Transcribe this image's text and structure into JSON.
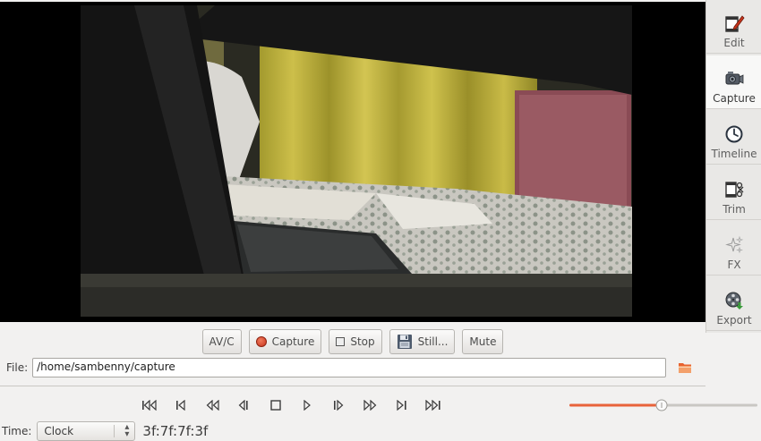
{
  "controls": {
    "avc_label": "AV/C",
    "capture_label": "Capture",
    "stop_label": "Stop",
    "still_label": "Still...",
    "mute_label": "Mute"
  },
  "file": {
    "label": "File:",
    "value": "/home/sambenny/capture"
  },
  "sidebar": {
    "items": [
      {
        "label": "Edit",
        "icon": "edit-icon"
      },
      {
        "label": "Capture",
        "icon": "camera-icon",
        "active": true
      },
      {
        "label": "Timeline",
        "icon": "clock-icon"
      },
      {
        "label": "Trim",
        "icon": "trim-icon"
      },
      {
        "label": "FX",
        "icon": "sparkle-icon"
      },
      {
        "label": "Export",
        "icon": "film-reel-icon"
      }
    ]
  },
  "transport": {
    "icons": [
      "start-icon",
      "previous-scene-icon",
      "rewind-icon",
      "step-back-icon",
      "stop-icon",
      "play-icon",
      "step-forward-icon",
      "fast-forward-icon",
      "next-scene-icon",
      "end-icon"
    ]
  },
  "volume": {
    "level": 0.49
  },
  "time": {
    "label": "Time:",
    "format": "Clock",
    "timecode": "3f:7f:7f:3f"
  },
  "colors": {
    "accent": "#e8633a",
    "record": "#d8402a"
  }
}
